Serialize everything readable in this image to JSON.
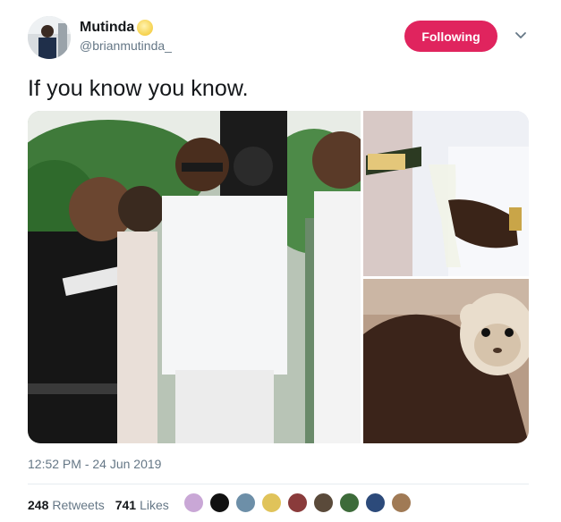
{
  "author": {
    "display_name": "Mutinda",
    "handle": "@brianmutinda_"
  },
  "follow_button": {
    "label": "Following",
    "color": "#e0245e"
  },
  "tweet": {
    "text": "If you know you know."
  },
  "timestamp": "12:52 PM - 24 Jun 2019",
  "stats": {
    "retweets_count": "248",
    "retweets_label": "Retweets",
    "likes_count": "741",
    "likes_label": "Likes"
  },
  "liker_avatars": [
    {
      "color": "#c9a7d6"
    },
    {
      "color": "#111111"
    },
    {
      "color": "#6d8fa8"
    },
    {
      "color": "#e0c35a"
    },
    {
      "color": "#8a3b3b"
    },
    {
      "color": "#5a4a3a"
    },
    {
      "color": "#3d6b3a"
    },
    {
      "color": "#2c4a7a"
    },
    {
      "color": "#a07a55"
    }
  ],
  "media": {
    "photo_count": 3,
    "left_photo_scene": "party-people-white-outfits",
    "top_right_photo_scene": "champagne-glass-pour",
    "bottom_right_photo_scene": "monkey-plush-on-wrist"
  }
}
